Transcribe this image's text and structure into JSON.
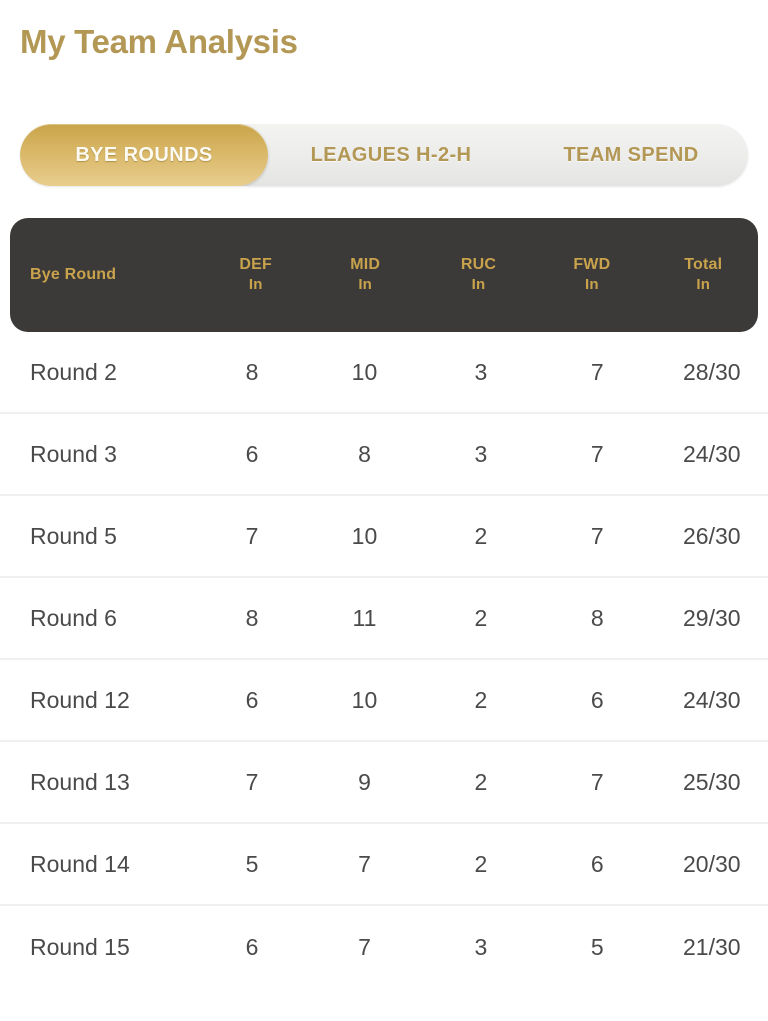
{
  "header": {
    "title": "My Team Analysis"
  },
  "tabs": [
    {
      "label": "BYE ROUNDS",
      "active": true,
      "name": "tab-bye-rounds"
    },
    {
      "label": "LEAGUES H-2-H",
      "active": false,
      "name": "tab-leagues-h2h"
    },
    {
      "label": "TEAM SPEND",
      "active": false,
      "name": "tab-team-spend"
    }
  ],
  "table": {
    "columns": [
      {
        "title": "Bye Round",
        "sub": ""
      },
      {
        "title": "DEF",
        "sub": "In"
      },
      {
        "title": "MID",
        "sub": "In"
      },
      {
        "title": "RUC",
        "sub": "In"
      },
      {
        "title": "FWD",
        "sub": "In"
      },
      {
        "title": "Total",
        "sub": "In"
      }
    ],
    "rows": [
      {
        "round": "Round 2",
        "def": "8",
        "mid": "10",
        "ruc": "3",
        "fwd": "7",
        "total": "28/30"
      },
      {
        "round": "Round 3",
        "def": "6",
        "mid": "8",
        "ruc": "3",
        "fwd": "7",
        "total": "24/30"
      },
      {
        "round": "Round 5",
        "def": "7",
        "mid": "10",
        "ruc": "2",
        "fwd": "7",
        "total": "26/30"
      },
      {
        "round": "Round 6",
        "def": "8",
        "mid": "11",
        "ruc": "2",
        "fwd": "8",
        "total": "29/30"
      },
      {
        "round": "Round 12",
        "def": "6",
        "mid": "10",
        "ruc": "2",
        "fwd": "6",
        "total": "24/30"
      },
      {
        "round": "Round 13",
        "def": "7",
        "mid": "9",
        "ruc": "2",
        "fwd": "7",
        "total": "25/30"
      },
      {
        "round": "Round 14",
        "def": "5",
        "mid": "7",
        "ruc": "2",
        "fwd": "6",
        "total": "20/30"
      },
      {
        "round": "Round 15",
        "def": "6",
        "mid": "7",
        "ruc": "3",
        "fwd": "5",
        "total": "21/30"
      }
    ]
  },
  "colors": {
    "gold": "#b39755",
    "gold_accent": "#c9a24c",
    "header_dark": "#3b3a38",
    "row_text": "#4a4a4a",
    "divider": "#f0f0f0"
  }
}
